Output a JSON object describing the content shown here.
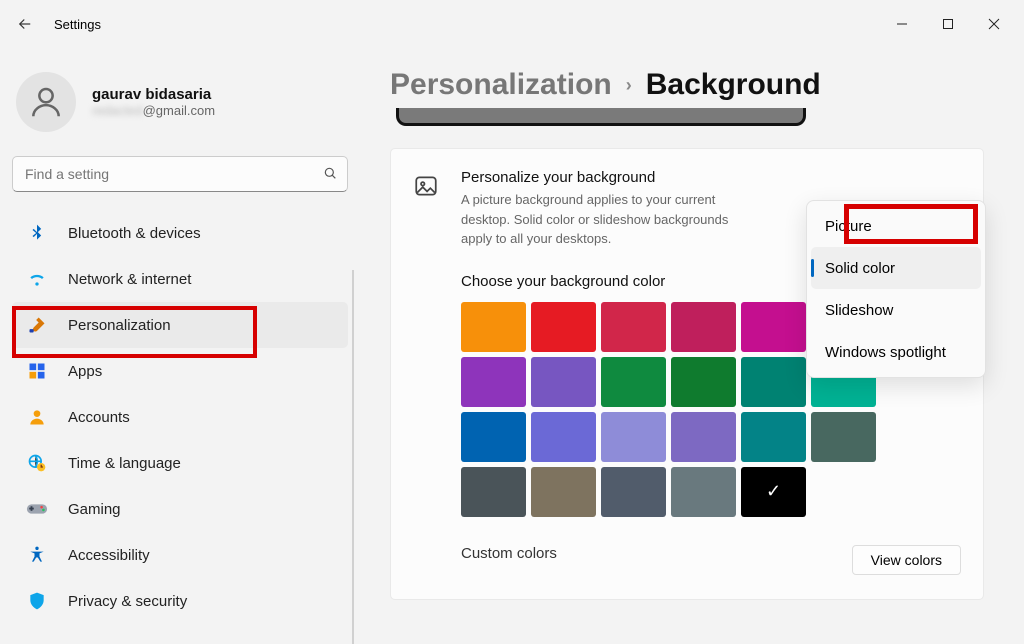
{
  "window": {
    "title": "Settings"
  },
  "profile": {
    "name": "gaurav bidasaria",
    "email_suffix": "@gmail.com",
    "email_redacted_prefix": "redacted"
  },
  "search": {
    "placeholder": "Find a setting"
  },
  "sidebar": {
    "items": [
      {
        "label": "Bluetooth & devices",
        "icon": "bluetooth-icon"
      },
      {
        "label": "Network & internet",
        "icon": "wifi-icon"
      },
      {
        "label": "Personalization",
        "icon": "paintbrush-icon",
        "active": true
      },
      {
        "label": "Apps",
        "icon": "apps-icon"
      },
      {
        "label": "Accounts",
        "icon": "account-icon"
      },
      {
        "label": "Time & language",
        "icon": "globe-clock-icon"
      },
      {
        "label": "Gaming",
        "icon": "gamepad-icon"
      },
      {
        "label": "Accessibility",
        "icon": "accessibility-icon"
      },
      {
        "label": "Privacy & security",
        "icon": "shield-icon"
      }
    ]
  },
  "breadcrumb": {
    "parent": "Personalization",
    "current": "Background"
  },
  "panel": {
    "title": "Personalize your background",
    "desc": "A picture background applies to your current desktop. Solid color or slideshow backgrounds apply to all your desktops."
  },
  "dropdown": {
    "options": [
      {
        "label": "Picture",
        "highlight_red": true
      },
      {
        "label": "Solid color",
        "selected": true
      },
      {
        "label": "Slideshow"
      },
      {
        "label": "Windows spotlight"
      }
    ]
  },
  "color_section": {
    "label": "Choose your background color",
    "colors": [
      "#f7900a",
      "#e61b23",
      "#d1264a",
      "#bf1f5c",
      "#c40f8f",
      "#a3008e",
      "#8e34bb",
      "#7756c1",
      "#0f8a3f",
      "#0f7b2e",
      "#008272",
      "#00b294",
      "#0063b1",
      "#6b69d6",
      "#8e8cd8",
      "#7d69c2",
      "#038387",
      "#486860",
      "#4a5459",
      "#7e735f",
      "#515c6b",
      "#69797e",
      "#000000"
    ],
    "selected_index": 22,
    "custom_label": "Custom colors",
    "view_button": "View colors"
  }
}
